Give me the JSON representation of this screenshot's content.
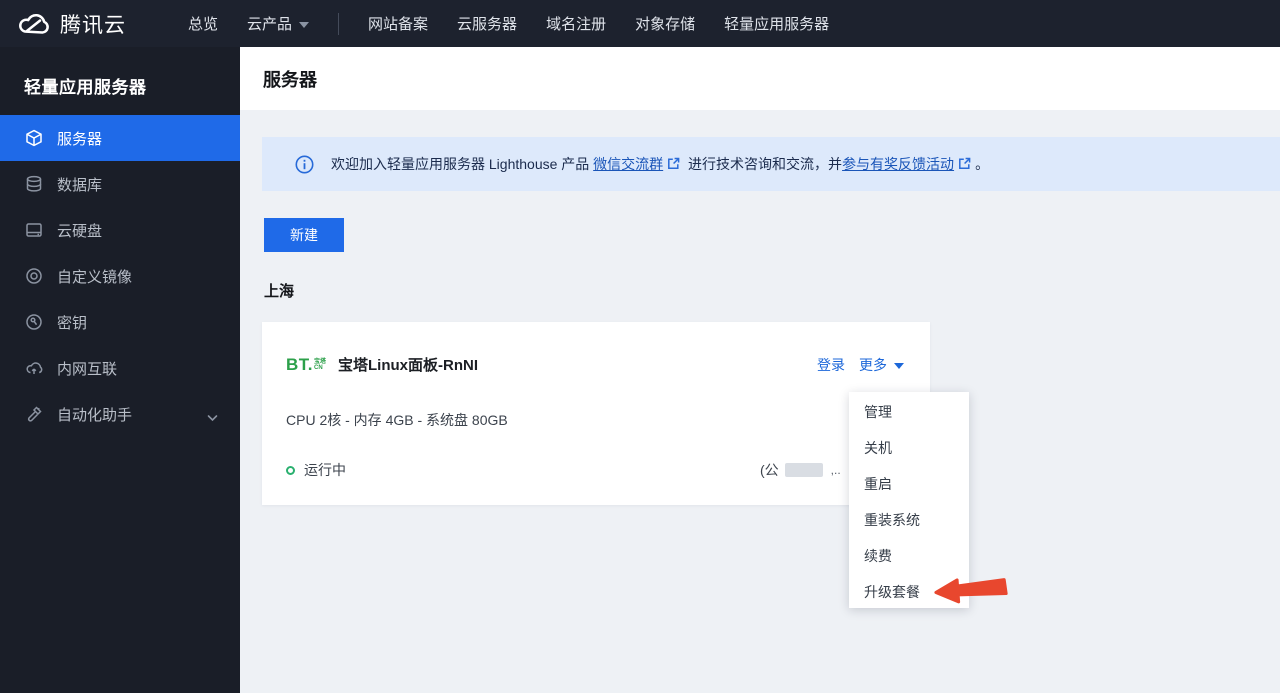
{
  "topnav": {
    "brand": "腾讯云",
    "items": [
      {
        "label": "总览"
      },
      {
        "label": "云产品",
        "icon": "caret-down-icon"
      },
      {
        "label": "网站备案"
      },
      {
        "label": "云服务器"
      },
      {
        "label": "域名注册"
      },
      {
        "label": "对象存储"
      },
      {
        "label": "轻量应用服务器"
      }
    ]
  },
  "sidebar": {
    "title": "轻量应用服务器",
    "items": [
      {
        "label": "服务器",
        "icon": "server-icon",
        "active": true
      },
      {
        "label": "数据库",
        "icon": "database-icon"
      },
      {
        "label": "云硬盘",
        "icon": "cloud-disk-icon"
      },
      {
        "label": "自定义镜像",
        "icon": "custom-image-icon"
      },
      {
        "label": "密钥",
        "icon": "key-icon"
      },
      {
        "label": "内网互联",
        "icon": "private-network-icon"
      },
      {
        "label": "自动化助手",
        "icon": "automation-icon",
        "chevron": "chevron-down-icon"
      }
    ]
  },
  "header": {
    "title": "服务器"
  },
  "banner": {
    "icon": "info-icon",
    "text_before": "欢迎加入轻量应用服务器 Lighthouse 产品 ",
    "link1": "微信交流群",
    "link_icon": "external-link-icon",
    "text_middle": " 进行技术咨询和交流，并",
    "link2": "参与有奖反馈活动",
    "text_after": "。"
  },
  "actions": {
    "create_button": "新建"
  },
  "region": {
    "label": "上海"
  },
  "server_card": {
    "logo": "baota-bt-logo",
    "logo_main": "BT.",
    "logo_small_top": "宝塔",
    "logo_small_bottom": "CN",
    "name": "宝塔Linux面板-RnNI",
    "login_link": "登录",
    "more_link": "更多",
    "spec": "CPU 2核 - 内存 4GB - 系统盘 80GB",
    "status": "运行中",
    "ip_prefix": "(公",
    "ip_fragment": ",.."
  },
  "dropdown": {
    "items": [
      "管理",
      "关机",
      "重启",
      "重装系统",
      "续费",
      "升级套餐"
    ]
  },
  "annotation": {
    "icon": "red-arrow-pointer",
    "points_to": "升级套餐"
  },
  "colors": {
    "nav_bg": "#1d222e",
    "sidebar_bg": "#1a1e28",
    "accent_blue": "#1f6ae8",
    "link_blue": "#1c67d9",
    "banner_bg": "#dde9fb",
    "banner_link": "#1a55b8",
    "status_green": "#2ab06f",
    "bt_green": "#2ca04a",
    "arrow_red": "#e8472e",
    "content_bg": "#eef1f5"
  }
}
